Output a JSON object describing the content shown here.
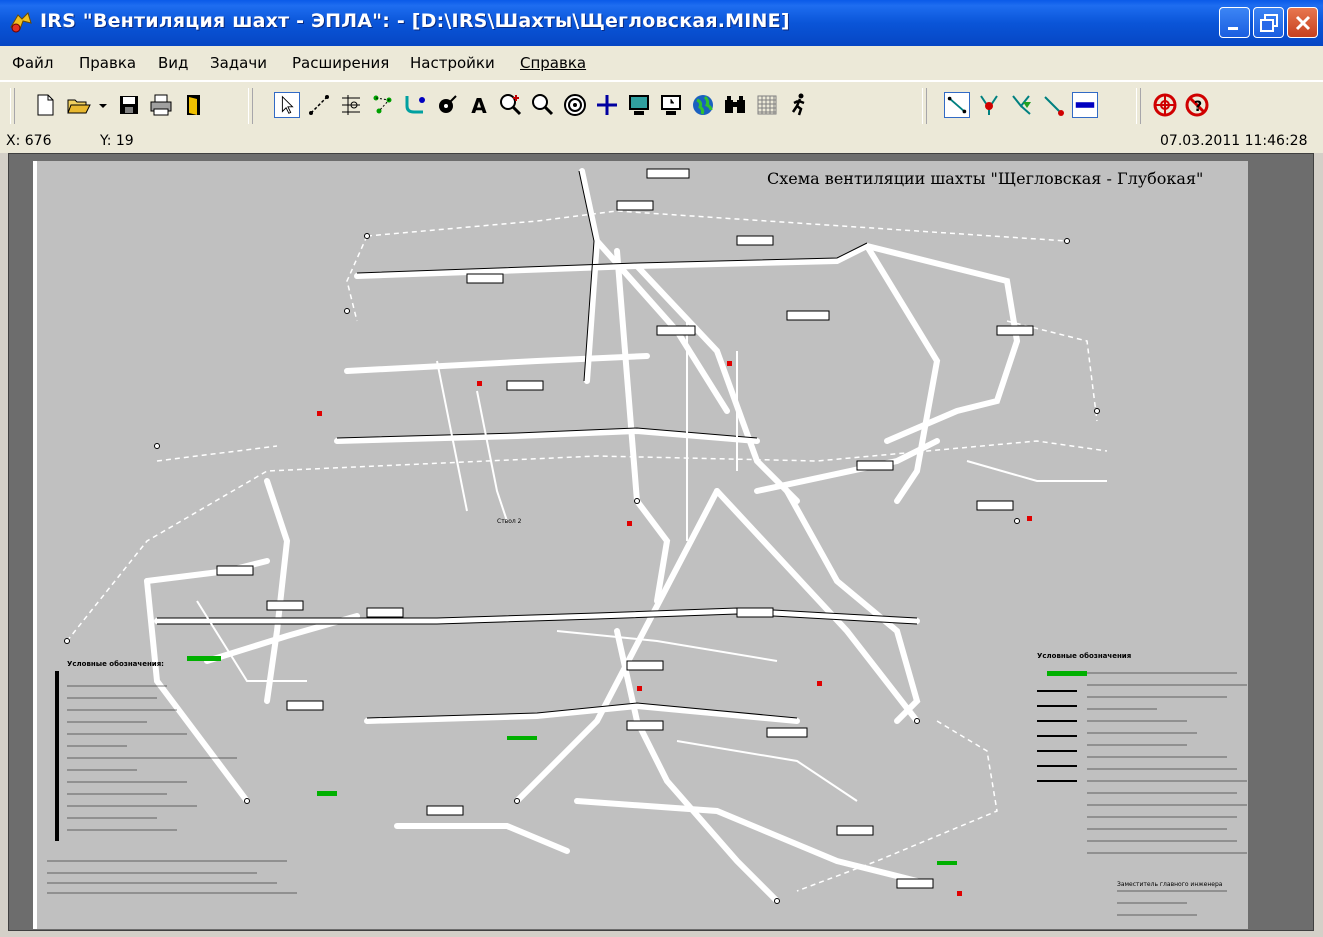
{
  "window": {
    "title": "IRS \"Вентиляция шахт - ЭПЛА\": - [D:\\IRS\\Шахты\\Щегловская.MINE]"
  },
  "menu": {
    "items": [
      "Файл",
      "Правка",
      "Вид",
      "Задачи",
      "Расширения",
      "Настройки",
      "Справка"
    ]
  },
  "toolbar": {
    "buttons": [
      {
        "icon": "new-document-icon"
      },
      {
        "icon": "open-folder-icon"
      },
      {
        "icon": "save-disk-icon"
      },
      {
        "icon": "print-icon"
      },
      {
        "icon": "exit-door-icon"
      },
      {
        "icon": "select-arrow-icon"
      },
      {
        "icon": "draw-branch-icon"
      },
      {
        "icon": "node-grid-icon"
      },
      {
        "icon": "nodes-icon"
      },
      {
        "icon": "branch-node-icon"
      },
      {
        "icon": "fan-icon"
      },
      {
        "icon": "text-tool-icon"
      },
      {
        "icon": "zoom-in-icon"
      },
      {
        "icon": "zoom-icon"
      },
      {
        "icon": "target-icon"
      },
      {
        "icon": "crosshair-icon"
      },
      {
        "icon": "monitor-icon"
      },
      {
        "icon": "clock-monitor-icon"
      },
      {
        "icon": "globe-icon"
      },
      {
        "icon": "binoculars-icon"
      },
      {
        "icon": "grid-icon"
      },
      {
        "icon": "runner-icon"
      },
      {
        "icon": "branch-line-icon"
      },
      {
        "icon": "fork-red-icon"
      },
      {
        "icon": "fork-green-icon"
      },
      {
        "icon": "line-red-icon"
      },
      {
        "icon": "blue-bar-icon"
      },
      {
        "icon": "lifebuoy-icon"
      },
      {
        "icon": "stop-help-icon"
      }
    ]
  },
  "status": {
    "x_label": "X: 676",
    "y_label": "Y: 19",
    "datetime": "07.03.2011 11:46:28"
  },
  "scheme": {
    "title": "Схема вентиляции шахты \"Щегловская - Глубокая\"",
    "legend_left_title": "Условные обозначения:",
    "legend_right_title": "Условные обозначения",
    "shaft_label": "Ствол 2",
    "footer_label": "Заместитель главного инженера"
  },
  "colors": {
    "titlebar": "#0a55d8",
    "sheet_bg": "#c0c0c0",
    "canvas_bg": "#6d6d6d",
    "workings": "#ffffff"
  }
}
